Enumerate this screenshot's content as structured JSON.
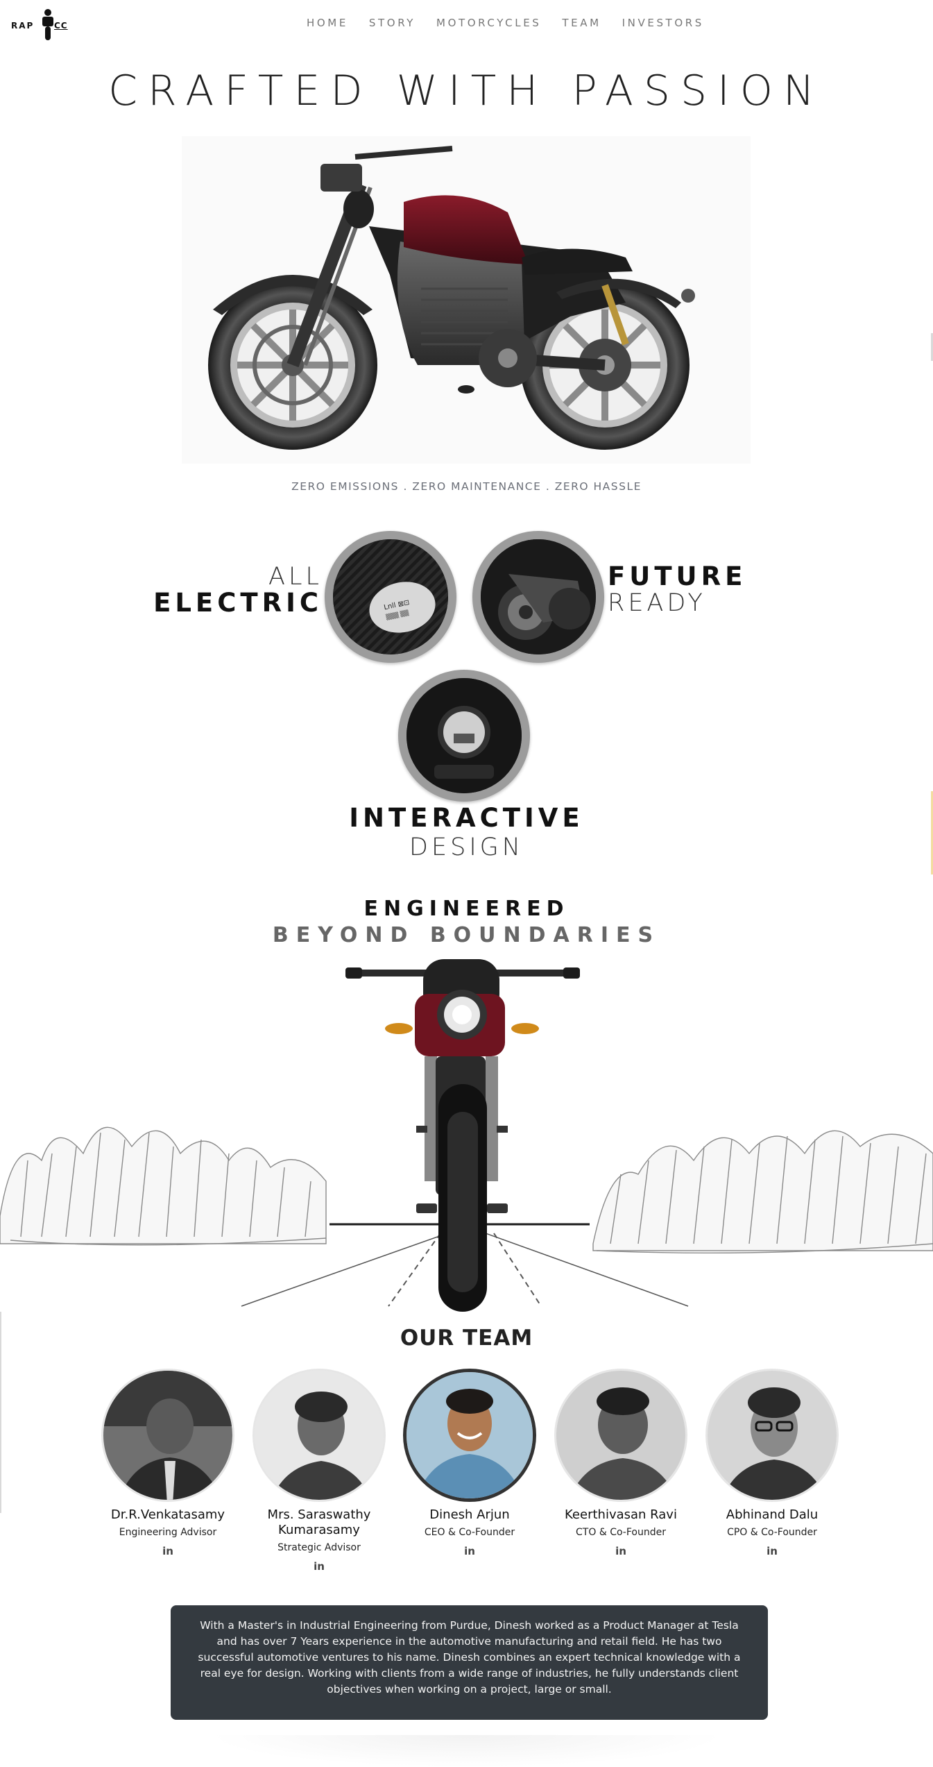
{
  "header": {
    "logo_text": "RAP",
    "logo_suffix": "CC",
    "nav": [
      "HOME",
      "STORY",
      "MOTORCYCLES",
      "TEAM",
      "INVESTORS"
    ]
  },
  "hero": {
    "title": "CRAFTED WITH PASSION",
    "tagline": "ZERO EMISSIONS . ZERO MAINTENANCE . ZERO HASSLE"
  },
  "features": {
    "electric": {
      "light": "ALL",
      "bold": "ELECTRIC"
    },
    "future": {
      "bold": "FUTURE",
      "light": "READY"
    },
    "interactive": {
      "bold": "INTERACTIVE",
      "light": "DESIGN"
    }
  },
  "engineered": {
    "title": "ENGINEERED",
    "subtitle": "BEYOND BOUNDARIES"
  },
  "team": {
    "title": "OUR TEAM",
    "members": [
      {
        "name": "Dr.R.Venkatasamy",
        "role": "Engineering Advisor",
        "link": "in"
      },
      {
        "name": "Mrs. Saraswathy Kumarasamy",
        "role": "Strategic Advisor",
        "link": "in"
      },
      {
        "name": "Dinesh Arjun",
        "role": "CEO & Co-Founder",
        "link": "in"
      },
      {
        "name": "Keerthivasan Ravi",
        "role": "CTO & Co-Founder",
        "link": "in"
      },
      {
        "name": "Abhinand Dalu",
        "role": "CPO & Co-Founder",
        "link": "in"
      }
    ],
    "bio": "With a Master's in Industrial Engineering from Purdue, Dinesh worked as a Product Manager at Tesla and has over 7 Years experience in the automotive manufacturing and retail field. He has two successful automotive ventures to his name. Dinesh combines an expert technical knowledge with a real eye for design. Working with clients from a wide range of industries, he fully understands client objectives when working on a project, large or small."
  },
  "colors": {
    "bio_bg": "#343a40",
    "bike_tank": "#6e1420",
    "nav_text": "#777777"
  }
}
